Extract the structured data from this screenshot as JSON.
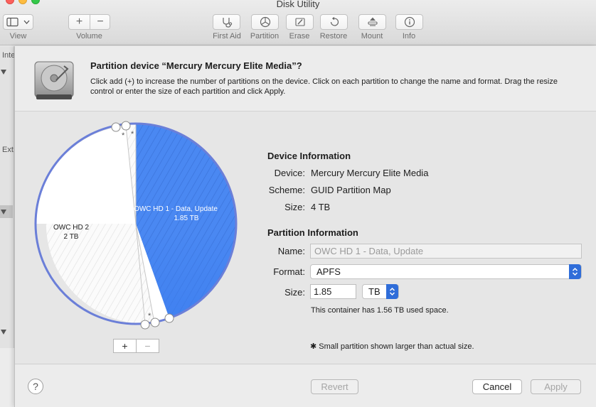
{
  "window": {
    "title": "Disk Utility"
  },
  "toolbar": {
    "view_label": "View",
    "volume_label": "Volume",
    "volume_add": "+",
    "volume_remove": "−",
    "buttons": [
      {
        "label": "First Aid",
        "icon": "stethoscope-icon"
      },
      {
        "label": "Partition",
        "icon": "pie-icon"
      },
      {
        "label": "Erase",
        "icon": "erase-icon"
      },
      {
        "label": "Restore",
        "icon": "restore-icon"
      },
      {
        "label": "Mount",
        "icon": "mount-icon"
      },
      {
        "label": "Info",
        "icon": "info-icon"
      }
    ]
  },
  "sidebar": {
    "internal_fragment": "Inte",
    "external_fragment": "Ext"
  },
  "sheet": {
    "title": "Partition device “Mercury Mercury Elite Media”?",
    "description": "Click add (+) to increase the number of partitions on the device. Click on each partition to change the name and format. Drag the resize control or enter the size of each partition and click Apply.",
    "pie": {
      "partitions": [
        {
          "name": "OWC HD 1 - Data, Update",
          "size": "1.85 TB",
          "selected": true,
          "color": "#3d7ff0"
        },
        {
          "name": "OWC HD 2",
          "size": "2 TB",
          "selected": false,
          "color": "#ffffff"
        }
      ],
      "small_marker": "*",
      "add_label": "+",
      "remove_label": "−"
    },
    "device_info": {
      "title": "Device Information",
      "device_label": "Device:",
      "device_value": "Mercury Mercury Elite Media",
      "scheme_label": "Scheme:",
      "scheme_value": "GUID Partition Map",
      "size_label": "Size:",
      "size_value": "4 TB"
    },
    "partition_info": {
      "title": "Partition Information",
      "name_label": "Name:",
      "name_value": "OWC HD 1 - Data, Update",
      "format_label": "Format:",
      "format_value": "APFS",
      "size_label": "Size:",
      "size_value": "1.85",
      "unit_value": "TB",
      "used_space": "This container has 1.56 TB used space."
    },
    "footnote": "✱ Small partition shown larger than actual size.",
    "buttons": {
      "help": "?",
      "revert": "Revert",
      "cancel": "Cancel",
      "apply": "Apply"
    }
  },
  "colors": {
    "accent": "#2f6dd9",
    "selected_partition": "#3d7ff0",
    "pie_border": "#6b7fd8"
  }
}
